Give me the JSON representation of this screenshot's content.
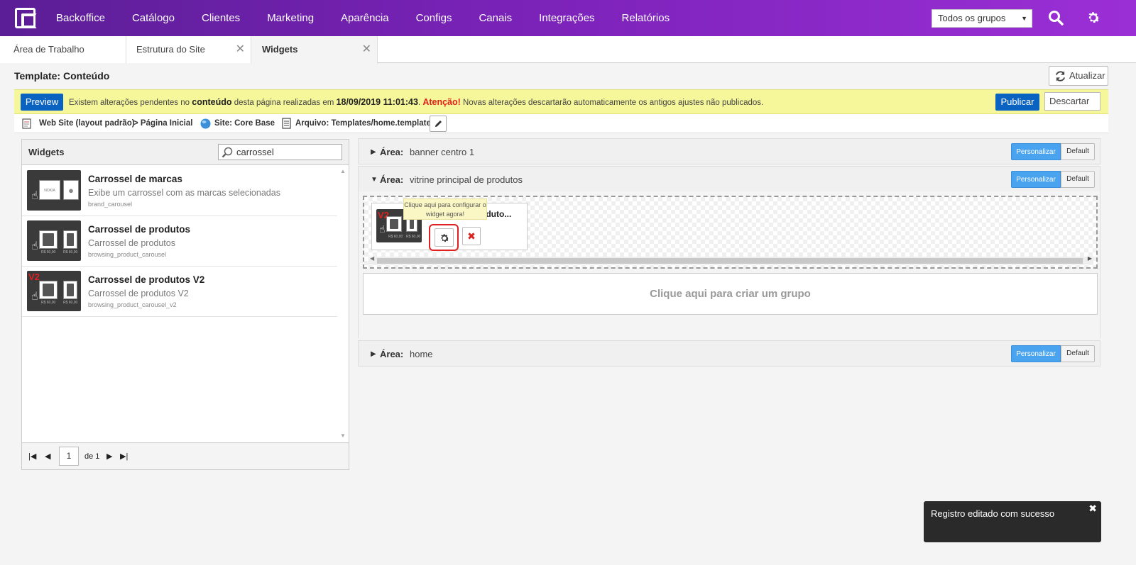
{
  "nav": {
    "items": [
      "Backoffice",
      "Catálogo",
      "Clientes",
      "Marketing",
      "Aparência",
      "Configs",
      "Canais",
      "Integrações",
      "Relatórios"
    ],
    "group_select": "Todos os grupos"
  },
  "tabs": [
    {
      "label": "Área de Trabalho"
    },
    {
      "label": "Estrutura do Site",
      "close": "✕"
    },
    {
      "label": "Widgets",
      "close": "✕"
    }
  ],
  "header": {
    "title": "Template: Conteúdo",
    "refresh_label": "Atualizar"
  },
  "warning": {
    "preview_label": "Preview",
    "text_1": "Existem alterações pendentes no ",
    "text_bold": "conteúdo",
    "text_2": " desta página realizadas em ",
    "datetime": "18/09/2019 11:01:43",
    "text_3": ". ",
    "attention": "Atenção!",
    "text_4": " Novas alterações descartarão automaticamente os antigos ajustes não publicados.",
    "publish_label": "Publicar",
    "discard_label": "Descartar"
  },
  "breadcrumb": {
    "layout": "Web Site (layout padrão)",
    "page": "> Página Inicial",
    "site": "Site: Core Base",
    "file": "Arquivo: Templates/home.template"
  },
  "widgets_panel": {
    "title": "Widgets",
    "search_value": "carrossel",
    "items": [
      {
        "name": "Carrossel de marcas",
        "description": "Exibe um carrossel com as marcas selecionadas",
        "code": "brand_carousel"
      },
      {
        "name": "Carrossel de produtos",
        "description": "Carrossel de produtos",
        "code": "browsing_product_carousel",
        "price": "R$ 60,00"
      },
      {
        "name": "Carrossel de produtos V2",
        "description": "Carrossel de produtos V2",
        "code": "browsing_product_carousel_v2",
        "price": "R$ 60,00",
        "badge": "V2"
      }
    ],
    "pager": {
      "page": "1",
      "of": "de 1"
    },
    "brand_logo_text": "NOKIA"
  },
  "areas": [
    {
      "label": "Área:",
      "name": "banner centro 1",
      "toggle": "▶",
      "customize": "Personalizar",
      "default": "Default"
    },
    {
      "label": "Área:",
      "name": "vitrine principal de produtos",
      "toggle": "▼",
      "customize": "Personalizar",
      "default": "Default"
    },
    {
      "label": "Área:",
      "name": "home",
      "toggle": "▶",
      "customize": "Personalizar",
      "default": "Default"
    }
  ],
  "dropzone": {
    "widget_name": "produto...",
    "tooltip": "Clique aqui para configurar o widget agora!",
    "create_group": "Clique aqui para criar um grupo"
  },
  "toast": {
    "message": "Registro editado com sucesso"
  },
  "colors": {
    "topbar_start": "#5b1e96",
    "topbar_end": "#9b2fd6",
    "primary_button": "#0b63c1",
    "customize_button": "#4aa3ef",
    "warning_bg": "#f6f79a",
    "attention_red": "#e0201c"
  }
}
